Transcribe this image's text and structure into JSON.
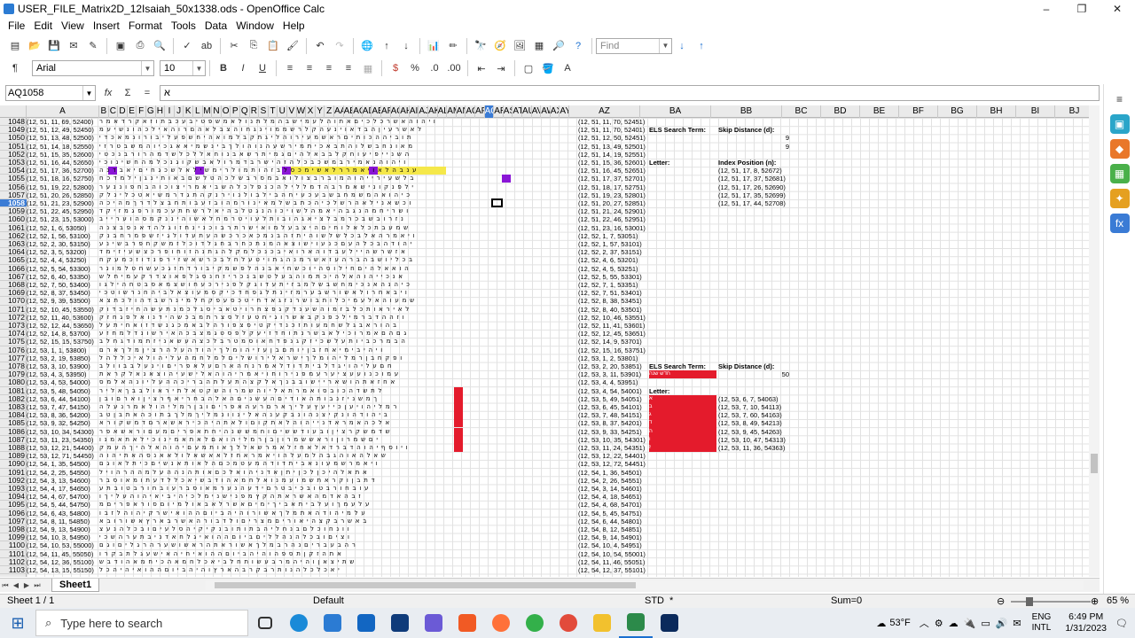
{
  "window": {
    "title": "USER_FILE_Matrix2D_12Isaiah_50x1338.ods - OpenOffice Calc",
    "controls": {
      "minimize": "–",
      "maximize": "❐",
      "close": "✕"
    }
  },
  "menu": [
    "File",
    "Edit",
    "View",
    "Insert",
    "Format",
    "Tools",
    "Data",
    "Window",
    "Help"
  ],
  "toolbar": {
    "find_placeholder": "Find",
    "font_name": "Arial",
    "font_size": "10",
    "bold": "B",
    "italic": "I",
    "underline": "U"
  },
  "formula_bar": {
    "name_box": "AQ1058",
    "fx": "fx",
    "sum": "Σ",
    "equals": "=",
    "content": "א"
  },
  "columns": [
    "A",
    "B",
    "C",
    "D",
    "E",
    "F",
    "G",
    "H",
    "I",
    "J",
    "K",
    "L",
    "M",
    "N",
    "O",
    "P",
    "Q",
    "R",
    "S",
    "T",
    "U",
    "V",
    "W",
    "X",
    "Y",
    "Z",
    "AA",
    "AB",
    "AC",
    "AD",
    "AE",
    "AF",
    "AG",
    "AH",
    "AI",
    "AJ",
    "AK",
    "AL",
    "AM",
    "AN",
    "AO",
    "AP",
    "AQ",
    "AR",
    "AS",
    "AT",
    "AU",
    "AV",
    "AW",
    "AX",
    "AY",
    "AZ",
    "BA",
    "BB",
    "BC",
    "BD",
    "BE",
    "BF",
    "BG",
    "BH",
    "BI",
    "BJ"
  ],
  "rows": [
    "1048",
    "1049",
    "1050",
    "1051",
    "1052",
    "1053",
    "1054",
    "1055",
    "1056",
    "1057",
    "1058",
    "1059",
    "1060",
    "1061",
    "1062",
    "1063",
    "1064",
    "1065",
    "1066",
    "1067",
    "1068",
    "1069",
    "1070",
    "1071",
    "1072",
    "1073",
    "1074",
    "1075",
    "1076",
    "1077",
    "1078",
    "1079",
    "1080",
    "1081",
    "1082",
    "1083",
    "1084",
    "1085",
    "1086",
    "1087",
    "1088",
    "1089",
    "1090",
    "1091",
    "1092",
    "1093",
    "1094",
    "1095",
    "1096",
    "1097",
    "1098",
    "1099",
    "1100",
    "1101",
    "1102",
    "1103"
  ],
  "active_row": "1058",
  "col_a": [
    "(12, 51, 11, 69, 52400)",
    "(12, 51, 12, 49, 52450)",
    "(12, 51, 13, 48, 52500)",
    "(12, 51, 14, 18, 52550)",
    "(12, 51, 15, 35, 52600)",
    "(12, 51, 16, 44, 52650)",
    "(12, 51, 17, 36, 52700)",
    "(12, 51, 18, 16, 52750)",
    "(12, 51, 19, 22, 52800)",
    "(12, 51, 20, 26, 52850)",
    "(12, 51, 21, 23, 52900)",
    "(12, 51, 22, 45, 52950)",
    "(12, 51, 23, 15, 53000)",
    "(12, 52, 1, 6, 53050)",
    "(12, 52, 1, 56, 53100)",
    "(12, 52, 2, 30, 53150)",
    "(12, 52, 3, 5, 53200)",
    "(12, 52, 4, 4, 53250)",
    "(12, 52, 5, 54, 53300)",
    "(12, 52, 6, 40, 53350)",
    "(12, 52, 7, 50, 53400)",
    "(12, 52, 8, 37, 53450)",
    "(12, 52, 9, 39, 53500)",
    "(12, 52, 10, 45, 53550)",
    "(12, 52, 11, 40, 53600)",
    "(12, 52, 12, 44, 53650)",
    "(12, 52, 14, 8, 53700)",
    "(12, 52, 15, 15, 53750)",
    "(12, 53, 1, 1, 53800)",
    "(12, 53, 2, 19, 53850)",
    "(12, 53, 3, 10, 53900)",
    "(12, 53, 4, 3, 53950)",
    "(12, 53, 4, 53, 54000)",
    "(12, 53, 5, 48, 54050)",
    "(12, 53, 6, 44, 54100)",
    "(12, 53, 7, 47, 54150)",
    "(12, 53, 8, 36, 54200)",
    "(12, 53, 9, 32, 54250)",
    "(12, 53, 10, 34, 54300)",
    "(12, 53, 11, 23, 54350)",
    "(12, 53, 12, 21, 54400)",
    "(12, 53, 12, 71, 54450)",
    "(12, 54, 1, 35, 54500)",
    "(12, 54, 2, 25, 54550)",
    "(12, 54, 3, 13, 54600)",
    "(12, 54, 4, 17, 54650)",
    "(12, 54, 4, 67, 54700)",
    "(12, 54, 5, 44, 54750)",
    "(12, 54, 6, 43, 54800)",
    "(12, 54, 8, 11, 54850)",
    "(12, 54, 9, 13, 54900)",
    "(12, 54, 10, 3, 54950)",
    "(12, 54, 10, 53, 55000)",
    "(12, 54, 11, 45, 55050)",
    "(12, 54, 12, 36, 55100)",
    "(12, 54, 13, 15, 55150)"
  ],
  "col_az": [
    "(12, 51, 11, 70, 52451)",
    "(12, 51, 11, 70, 52401)",
    "(12, 51, 12, 50, 52451)",
    "(12, 51, 13, 49, 52501)",
    "(12, 51, 14, 19, 52551)",
    "(12, 51, 15, 36, 52601)",
    "(12, 51, 16, 45, 52651)",
    "(12, 51, 17, 37, 52701)",
    "(12, 51, 18, 17, 52751)",
    "(12, 51, 19, 23, 52801)",
    "(12, 51, 20, 27, 52851)",
    "(12, 51, 21, 24, 52901)",
    "(12, 51, 22, 46, 52951)",
    "(12, 51, 23, 16, 53001)",
    "(12, 52, 1, 7, 53051)",
    "(12, 52, 1, 57, 53101)",
    "(12, 52, 2, 37, 53151)",
    "(12, 52, 4, 6, 53201)",
    "(12, 52, 4, 5, 53251)",
    "(12, 52, 5, 55, 53301)",
    "(12, 52, 7, 1, 53351)",
    "(12, 52, 7, 51, 53401)",
    "(12, 52, 8, 38, 53451)",
    "(12, 52, 8, 40, 53501)",
    "(12, 52, 10, 46, 53551)",
    "(12, 52, 11, 41, 53601)",
    "(12, 52, 12, 45, 53651)",
    "(12, 52, 14, 9, 53701)",
    "(12, 52, 15, 16, 53751)",
    "(12, 53, 1, 2, 53801)",
    "(12, 53, 2, 20, 53851)",
    "(12, 53, 3, 11, 53901)",
    "(12, 53, 4, 4, 53951)",
    "(12, 53, 4, 54, 54001)",
    "(12, 53, 5, 49, 54051)",
    "(12, 53, 6, 45, 54101)",
    "(12, 53, 7, 48, 54151)",
    "(12, 53, 8, 37, 54201)",
    "(12, 53, 9, 33, 54251)",
    "(12, 53, 10, 35, 54301)",
    "(12, 53, 11, 24, 54351)",
    "(12, 53, 12, 22, 54401)",
    "(12, 53, 12, 72, 54451)",
    "(12, 54, 1, 36, 54501)",
    "(12, 54, 2, 26, 54551)",
    "(12, 54, 3, 14, 54601)",
    "(12, 54, 4, 18, 54651)",
    "(12, 54, 4, 68, 54701)",
    "(12, 54, 5, 45, 54751)",
    "(12, 54, 6, 44, 54801)",
    "(12, 54, 8, 12, 54851)",
    "(12, 54, 9, 14, 54901)",
    "(12, 54, 10, 4, 54951)",
    "(12, 54, 10, 54, 55001)",
    "(12, 54, 11, 46, 55051)",
    "(12, 54, 12, 37, 55101)"
  ],
  "hebrew_rows": [
    "ויהוהאשרכלכיםאתוהלעמישבהמלתנולאמשפטיבעכבתוזאקרדאמר",
    "לאשרעיןהבדאוינעהקלרשממוינגחוהצבלאהםרוהאילכהונשיעמ",
    "תוביההכותיםראשמעירוהליגתקבלמואהיחשפעליבורונמאכדי",
    "מאונחבשלוהתבאכיתמירשעהנוהולךבינשמיאאגכיוהמשבטרזי",
    "השנייפיעוחקלבבאלהיםגמיתרשאבנוחאללכלשדמהרורבנכטי",
    "ויהוהנאמירבמשכבכלהזהישרבדמרולאבשקוגנכלמהחשינוכי",
    "ענבהלאויאמררלאשימכסלבזהותמולרימשילאלשכגחיםיאבדנה",
    "בלשעירייהוהמוברבצולואבמסרבשלכהטלשםבאותינגןילמדכח",
    "ילפנקונישאמרבהדמללילהכנפלכלהשביאמריצוכוהבחפוננער",
    "כיהואהמשמחבשבעכעיחהבילבולנוירנקהתגדרמשיאטכלינלק",
    "וכשאנילאהרשלכיהכתבשלמאינורמהובזעבותחבצלדרךמהיכה",
    "ושריחמהנגבהיאמהלשויכוהנגטלבהיאלרשחתעכמורפגמזיקד",
    "נזרובשבכרמבלציאגהובותלעויטרמחלאשוהיננקמסהוערייב",
    "שמעבתכלאלוחיםהיצבעלמואישרתרבוכנינחזוגלהדאנפבצנה",
    "ויאמרהאלבכלשלשוהיתזהבנמכאכרכשהעתעדולגיזשפמרחבנק",
    "יהודהבכלהעםכנעוישוצאהמנתכחרבחגלדוכלזמשקחפרבשינע",
    "אזשרשהיילעבדוהארואיבכנכלמקלהגתנהזוחופרכצשעיזימד",
    "בכליושבהברהעזאשרמנהגתויטעלחלבכרשאשזירפנדוזכמעקח",
    "הואאלהיםחילוסהיוכשחיאבנהלפשמקיבורדתזגכעשחטלמונר",
    "אנכייהוהאלהיכתמוהבעלטשבנכריזחנסגלפאוצדרקעמיחלש",
    "כיהנהאנכימחשבשלמבזיתעדוגקלפנירכעחושצמאסבטחהילגו",
    "ויבאחרולאשורשבערמזינתלגפחדכיקסמעוצאלביהחנרשוטכי",
    "שמעוהאלעמיכלותבושרנזגאדחיטכסעפקחלמינרשבדהולכתצא",
    "לאיראותכלבזמוהשענדקגפצחרויטאביסגלכמנתעשהחיזבדוק",
    "וזההדברמילכפנקבאשרוגיחטעזלסצרתמבכשהידנואלפגחזק",
    "בהוראבגלשחמעותזכנדיקטיסצפורהלבאמכגנשדזואחיתעל",
    "גםהםאמרוכילאבשרנתוחדזיעקלפסטגמצבכהאירשונדלמחזע",
    "הבמרכביותעלשכיזקגנפדחאוסמטרבלכצהעשאניזתמודגחלב",
    "ויהיבימיאחזבןיותםבןעזיהומלךיהודהעלהרציןמלךארם",
    "ופקחבןרמליהומלךישראלירושליםלמלחמהעליהולאיכללהל",
    "חםעליהויגדלביתדודלאמרנחהארםעלאפריםוינעלבבוולב",
    "עמוכנועעציערעמפנירוחויאמריהוהאלישעיהוצאנאלקראת",
    "אחזאתהושאריישובבנךאלקצהתעלתהבריכההעליונהאלמס",
    "לתשדהכובסואמרתאליוהשמרוהשקטאלתיראולבבךאליר",
    "ךמשניזנבותהאודיםהעשניםהאלהבחריאףרציןוארםובן",
    "רמליהויעןכייעץעליךארםרעהאפריםובןרמליהולאמרנעלה",
    "ביהודהונקיצנהונבקענהאלינוונמליךמלךבתוכהאתבןטב",
    "אלכהאמראדנייהוהלאתקוםולאתהיהכיראשארםדמשקורא",
    "שדמשקרציןובעודששיםוחמששנהיחתאפריםמעםוראשאפר",
    "יםשמרוןוראששמרוןבןרמליהואםלאתאמינוכילאתאמנו",
    "ויוסףיהוהדברדאלאחזלאמרשאללךאותמעםיהוהאלהיךהעמק",
    "שאלהאוהגבהלמעלהויאמראחזלאאשאלולאאנסהאתיהוה",
    "ויאמרשמעונאביתדודהמעטמכםהלאותאנשיםכיתלאוגם",
    "אתאלהיכןלכןיתןאדניהואלכםאותהנההעלמההרהויל",
    "דתבןוקראתשמועמנואלחמאהודבשיאכללדעתומאוסבר",
    "עובחורבטובכיבטרםידעהנערמאוסברעובחורבטובתע",
    "זבהאדמהאשראתהקץמפנישנימלכיהיביאיהוהעליךו",
    "עלעמךועלביתאביךימיםאשרלאבאולמיוםסוראפריםמ",
    "עלמיהודהאתמלךאשורוהיהביוםההואישרקיהוהלזבו",
    "באשרבקצהיאוריםמצריםולדבורהאשרבארץאשורובא",
    "וונחוכלםבנחליהבתותובנקיקיהסלעיםובכלהנעצ",
    "וציםובכלהנהלליםביוםההואיגלחאדניבתערהשכי",
    "רהבעבריםנהרבמלךאשוראתהראשושערהרגליםוגם",
    "אתהזקןתספהוהיהביוםההואיחיהאישעגלתבקרו",
    "שתיצאןוהיהמרבעשותחלביאכלחמאהכיחמאהודבש",
    "יאכלכלהנותרבקרבהארץוהיהביוםההואיהיהכל"
  ],
  "els_panel_1": {
    "term_label": "ELS Search Term:",
    "skip_label": "Skip Distance (d):",
    "skip_value_a": "9",
    "skip_value_b": "9",
    "letter_label": "Letter:",
    "index_label": "Index Position (n):",
    "index_values": [
      "(12, 51, 17, 8, 52672)",
      "(12, 51, 17, 37, 52681)",
      "(12, 51, 17, 26, 52690)",
      "(12, 51, 17, 35, 52699)",
      "(12, 51, 17, 44, 52708)"
    ]
  },
  "els_panel_2": {
    "term_label": "ELS Search Term:",
    "term_value": "חדש שנה",
    "skip_label": "Skip Distance (d):",
    "skip_value": "50",
    "letter_label": "Letter:",
    "letters": [
      "א",
      "ב",
      "ג",
      "ד",
      "ה",
      "ו",
      "ז"
    ],
    "index_values": [
      "(12, 53, 6, 7, 54063)",
      "(12, 53, 7, 10, 54113)",
      "(12, 53, 7, 60, 54163)",
      "(12, 53, 8, 49, 54213)",
      "(12, 53, 9, 45, 54263)",
      "(12, 53, 10, 47, 54313)",
      "(12, 53, 11, 36, 54363)"
    ]
  },
  "sheet_tab": "Sheet1",
  "status": {
    "sheet": "Sheet 1 / 1",
    "style": "Default",
    "mode": "STD",
    "modified": "*",
    "sum": "Sum=0",
    "zoom": "65 %"
  },
  "taskbar": {
    "search_placeholder": "Type here to search",
    "weather": "53°F",
    "lang_top": "ENG",
    "lang_bottom": "INTL",
    "time": "6:49 PM",
    "date": "1/31/2023"
  },
  "colors": {
    "purple": "#8a16d6",
    "red": "#e41b2c",
    "yellow": "#f5e84a",
    "active": "#3a7bd5"
  }
}
